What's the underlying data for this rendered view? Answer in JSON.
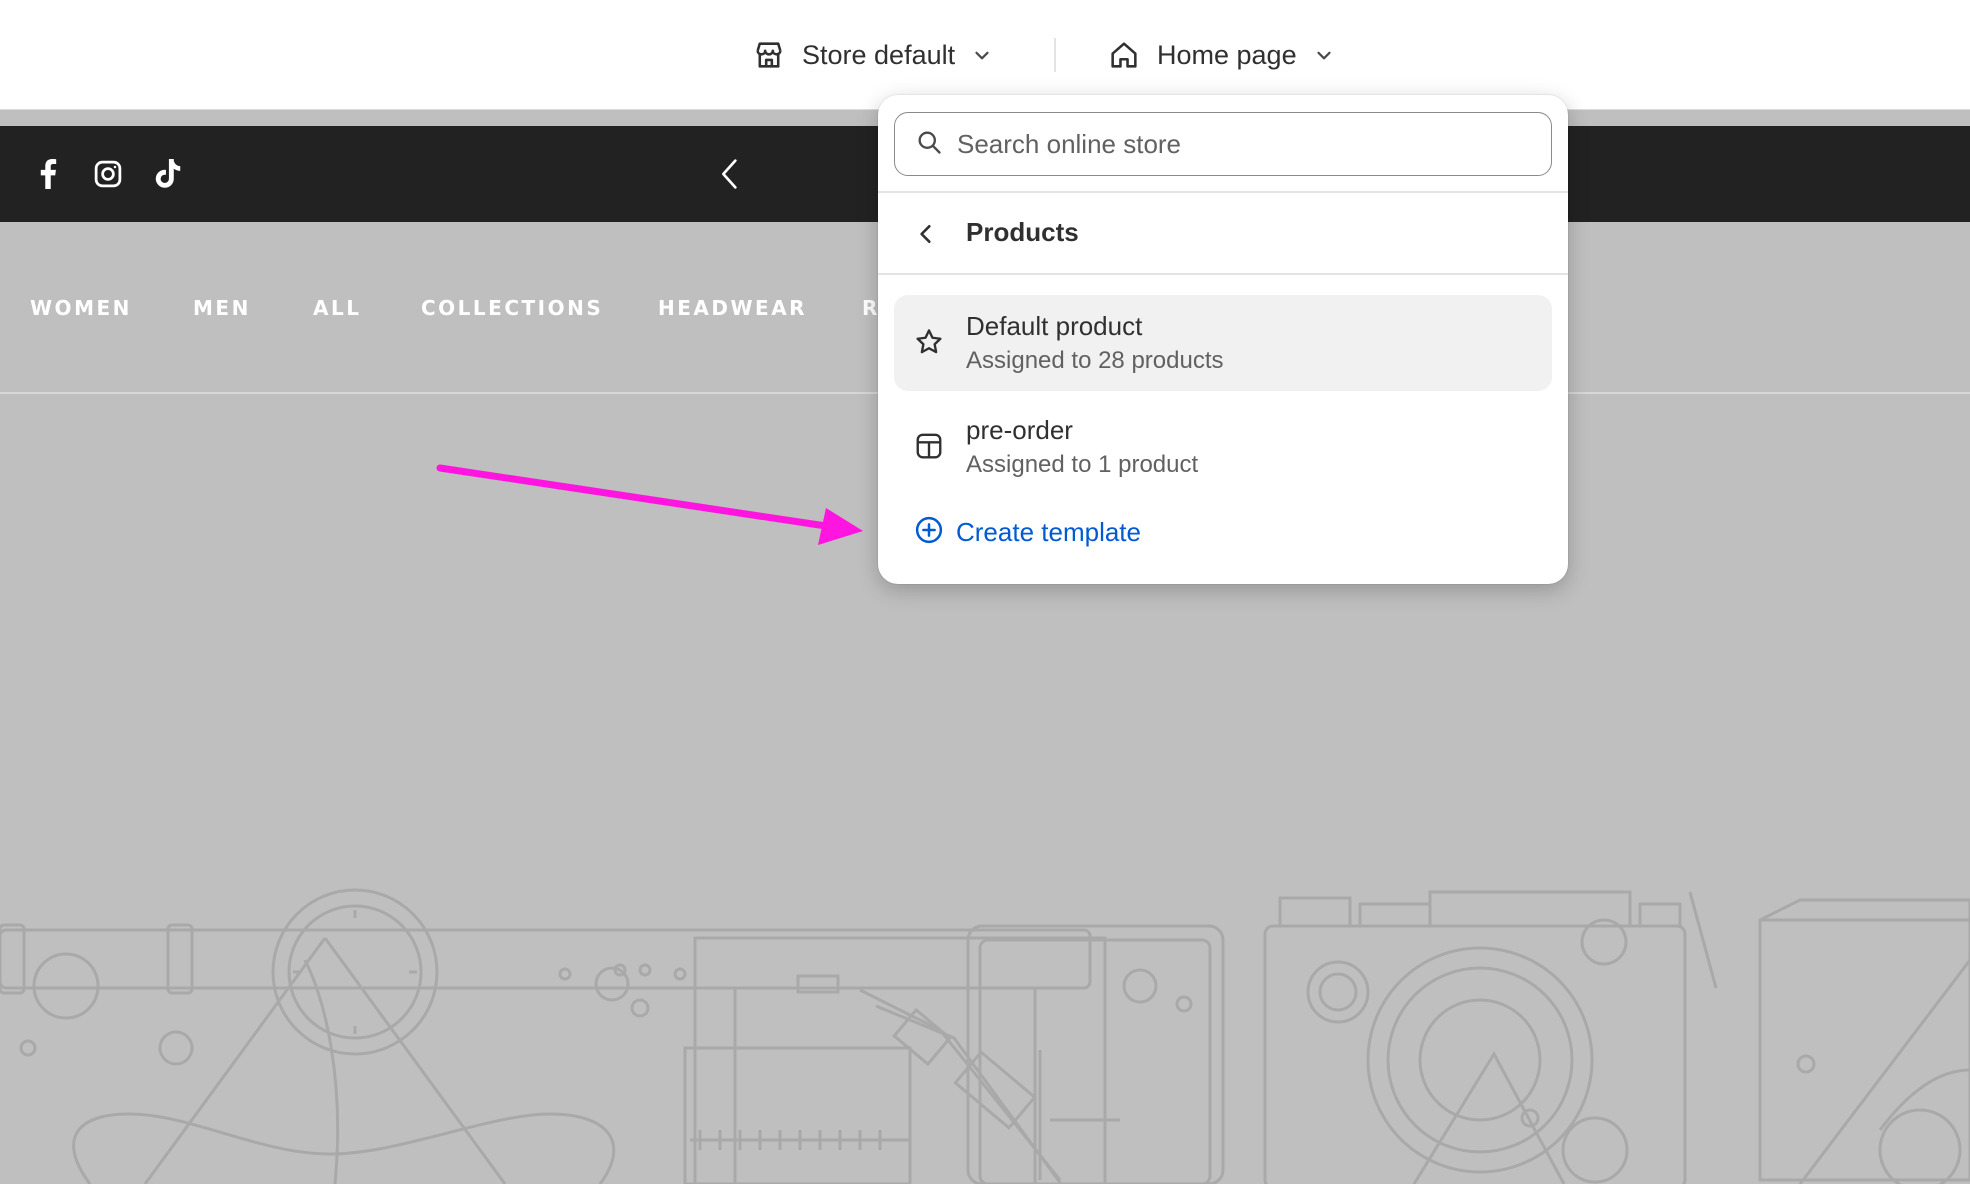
{
  "topbar": {
    "store_selector": {
      "label": "Store default",
      "icon": "store-icon"
    },
    "page_selector": {
      "label": "Home page",
      "icon": "home-icon"
    }
  },
  "announcement_bar": {
    "social_icons": [
      "facebook-icon",
      "instagram-icon",
      "tiktok-icon"
    ],
    "prev_icon": "chevron-left-icon"
  },
  "store_nav": {
    "items": [
      "WOMEN",
      "MEN",
      "ALL",
      "COLLECTIONS",
      "HEADWEAR",
      "R"
    ]
  },
  "dropdown": {
    "search": {
      "placeholder": "Search online store"
    },
    "section_title": "Products",
    "templates": [
      {
        "name": "Default product",
        "subtitle": "Assigned to 28 products",
        "icon": "star-icon",
        "selected": true
      },
      {
        "name": "pre-order",
        "subtitle": "Assigned to 1 product",
        "icon": "layout-icon",
        "selected": false
      }
    ],
    "create_label": "Create template"
  },
  "colors": {
    "accent_link": "#005bd3",
    "annotation_arrow": "#ff14e0",
    "announcement_bg": "#222222",
    "page_bg": "#bfbfbf"
  }
}
